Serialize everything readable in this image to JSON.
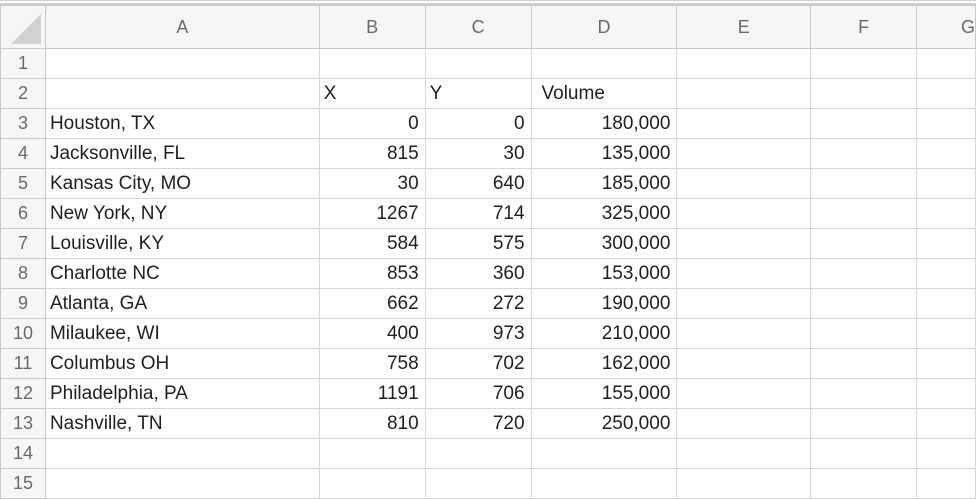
{
  "columns": [
    "A",
    "B",
    "C",
    "D",
    "E",
    "F",
    "G"
  ],
  "row_numbers": [
    "1",
    "2",
    "3",
    "4",
    "5",
    "6",
    "7",
    "8",
    "9",
    "10",
    "11",
    "12",
    "13",
    "14",
    "15"
  ],
  "table": {
    "header_x": "X",
    "header_y": "Y",
    "header_volume": "Volume",
    "rows": [
      {
        "city": "Houston, TX",
        "x": "0",
        "y": "0",
        "volume": "180,000"
      },
      {
        "city": "Jacksonville, FL",
        "x": "815",
        "y": "30",
        "volume": "135,000"
      },
      {
        "city": "Kansas City, MO",
        "x": "30",
        "y": "640",
        "volume": "185,000"
      },
      {
        "city": "New York, NY",
        "x": "1267",
        "y": "714",
        "volume": "325,000"
      },
      {
        "city": "Louisville, KY",
        "x": "584",
        "y": "575",
        "volume": "300,000"
      },
      {
        "city": "Charlotte NC",
        "x": "853",
        "y": "360",
        "volume": "153,000"
      },
      {
        "city": "Atlanta, GA",
        "x": "662",
        "y": "272",
        "volume": "190,000"
      },
      {
        "city": "Milaukee, WI",
        "x": "400",
        "y": "973",
        "volume": "210,000"
      },
      {
        "city": "Columbus OH",
        "x": "758",
        "y": "702",
        "volume": "162,000"
      },
      {
        "city": "Philadelphia, PA",
        "x": "1191",
        "y": "706",
        "volume": "155,000"
      },
      {
        "city": "Nashville, TN",
        "x": "810",
        "y": "720",
        "volume": "250,000"
      }
    ]
  },
  "colors": {
    "grid": "#d7d7d7",
    "header_bg": "#f6f6f6",
    "header_text": "#6a6a6a"
  }
}
